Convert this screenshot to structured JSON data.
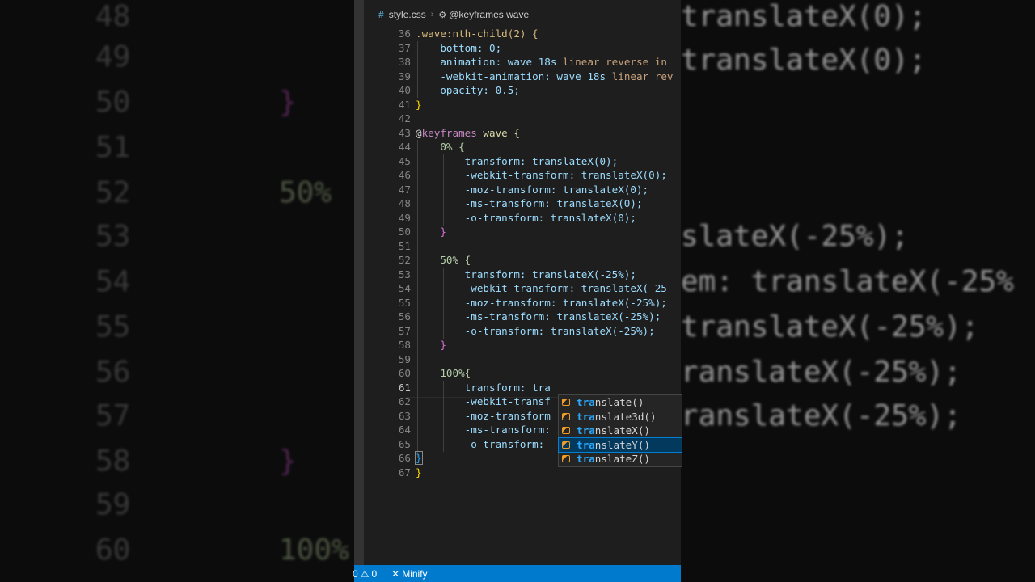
{
  "background": {
    "left_numbers": [
      "48",
      "49",
      "50",
      "51",
      "52",
      "53",
      "54",
      "55",
      "56",
      "57",
      "58",
      "59",
      "60"
    ],
    "left_50pct": "50%",
    "left_100pct": "100%",
    "right_lines": [
      "translateX(0);",
      "translateX(0);",
      "slateX(-25%);",
      "em: translateX(-25%",
      "translateX(-25%);",
      "ranslateX(-25%);",
      "ranslateX(-25%);"
    ]
  },
  "breadcrumb": {
    "file": "style.css",
    "symbol": "@keyframes wave"
  },
  "gutter": [
    "36",
    "37",
    "38",
    "39",
    "40",
    "41",
    "42",
    "43",
    "44",
    "45",
    "46",
    "47",
    "48",
    "49",
    "50",
    "51",
    "52",
    "53",
    "54",
    "55",
    "56",
    "57",
    "58",
    "59",
    "60",
    "61",
    "62",
    "63",
    "64",
    "65",
    "66",
    "67"
  ],
  "code": {
    "l36": ".wave:nth-child(2) {",
    "l37": "bottom: 0;",
    "l38a": "animation: wave 18s ",
    "l38b": "linear reverse in",
    "l39a": "-webkit-animation: wave 18s ",
    "l39b": "linear rev",
    "l40": "opacity: 0.5;",
    "l41": "}",
    "l43a": "@",
    "l43b": "keyframes",
    "l43c": " wave {",
    "l44": "0% {",
    "l45": "transform: translateX(0);",
    "l46": "-webkit-transform: translateX(0);",
    "l47": "-moz-transform: translateX(0);",
    "l48": "-ms-transform: translateX(0);",
    "l49": "-o-transform: translateX(0);",
    "l50": "}",
    "l52": "50% {",
    "l53": "transform: translateX(-25%);",
    "l54": "-webkit-transform: translateX(-25",
    "l55": "-moz-transform: translateX(-25%);",
    "l56": "-ms-transform: translateX(-25%);",
    "l57": "-o-transform: translateX(-25%);",
    "l58": "}",
    "l60": "100%{",
    "l61": "transform: tra",
    "l62": "-webkit-transf",
    "l63": "-moz-transform",
    "l64": "-ms-transform:",
    "l65": "-o-transform:",
    "l66": "}",
    "l67": "}"
  },
  "suggestions": [
    {
      "match": "tra",
      "rest": "nslate()"
    },
    {
      "match": "tra",
      "rest": "nslate3d()"
    },
    {
      "match": "tra",
      "rest": "nslateX()"
    },
    {
      "match": "tra",
      "rest": "nslateY()"
    },
    {
      "match": "tra",
      "rest": "nslateZ()"
    }
  ],
  "status": {
    "errors": "0",
    "warnings": "0",
    "minify": "Minify"
  },
  "colors": {
    "statusbar": "#007acc",
    "editor_bg": "#1e1e1e",
    "suggest_selected": "#04395e"
  }
}
